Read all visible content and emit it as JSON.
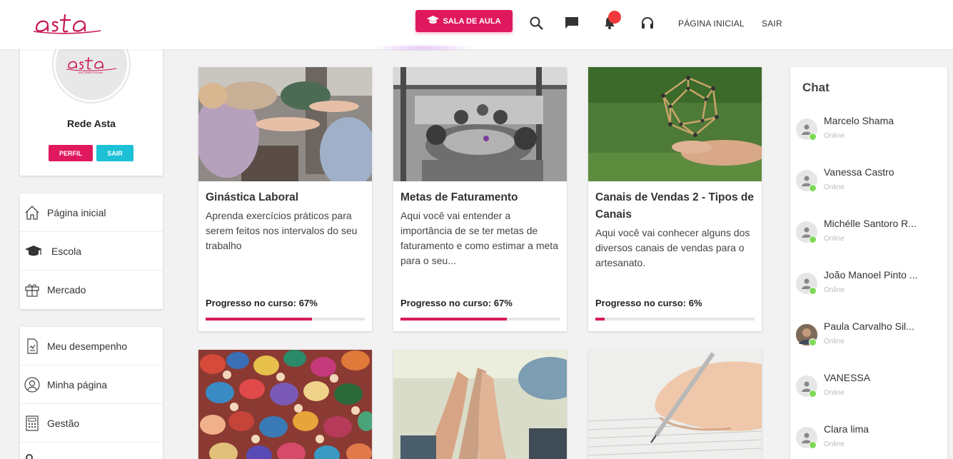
{
  "brand": {
    "logo_text": "asta",
    "logo_tagline": "bom, bonito e do bem",
    "accent": "#e0195f"
  },
  "header": {
    "sala_button": "SALA DE AULA",
    "links": [
      "PÁGINA INICIAL",
      "SAIR"
    ],
    "icons": [
      "search-icon",
      "chat-bubble-icon",
      "bell-icon",
      "headset-icon"
    ]
  },
  "profile": {
    "name": "Rede Asta",
    "perfil_button": "PERFIL",
    "sair_button": "SAIR",
    "colors": {
      "perfil": "#e0195f",
      "sair": "#1cc1d6"
    }
  },
  "sidebar": {
    "menu1": [
      {
        "label": "Página inicial",
        "icon": "home-icon"
      },
      {
        "label": "Escola",
        "icon": "graduation-cap-icon"
      },
      {
        "label": "Mercado",
        "icon": "gift-icon"
      }
    ],
    "menu2": [
      {
        "label": "Meu desempenho",
        "icon": "report-icon"
      },
      {
        "label": "Minha página",
        "icon": "user-circle-icon"
      },
      {
        "label": "Gestão",
        "icon": "calculator-icon"
      }
    ]
  },
  "courses": [
    {
      "title": "Ginástica Laboral",
      "description": "Aprenda exercícios práticos para serem feitos nos intervalos do seu trabalho",
      "progress_label": "Progresso no curso: 67%",
      "progress": 67
    },
    {
      "title": "Metas de Faturamento",
      "description": "Aqui você vai entender a importância de se ter metas de faturamento e como estimar a meta para o seu...",
      "progress_label": "Progresso no curso: 67%",
      "progress": 67
    },
    {
      "title": "Canais de Vendas 2 - Tipos de Canais",
      "description": "Aqui você vai conhecer alguns dos diversos canais de vendas para o artesanato.",
      "progress_label": "Progresso no curso: 6%",
      "progress": 6
    }
  ],
  "chat": {
    "title": "Chat",
    "users": [
      {
        "name": "Marcelo Shama",
        "status": "Online"
      },
      {
        "name": "Vanessa Castro",
        "status": "Online"
      },
      {
        "name": "Michélle Santoro R...",
        "status": "Online"
      },
      {
        "name": "João Manoel Pinto ...",
        "status": "Online"
      },
      {
        "name": "Paula Carvalho Sil...",
        "status": "Online"
      },
      {
        "name": "VANESSA",
        "status": "Online"
      },
      {
        "name": "Clara lima",
        "status": "Online"
      }
    ]
  }
}
